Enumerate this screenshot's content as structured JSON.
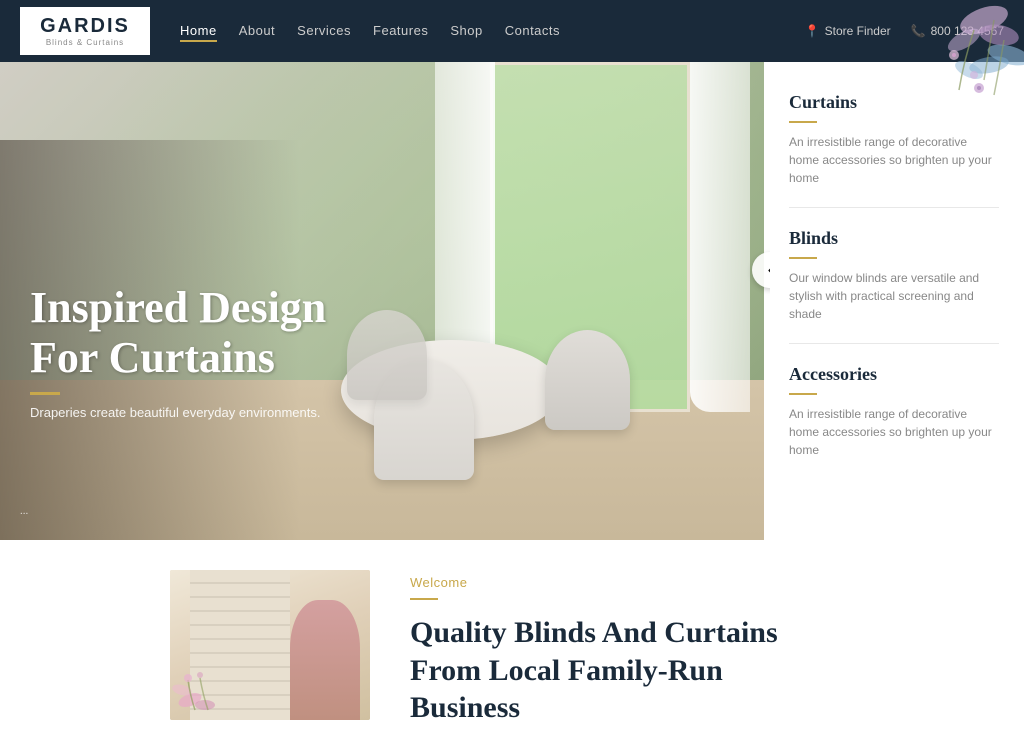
{
  "brand": {
    "name": "GARDIS",
    "sub": "Blinds & Curtains"
  },
  "navbar": {
    "links": [
      {
        "label": "Home",
        "active": true
      },
      {
        "label": "About",
        "active": false
      },
      {
        "label": "Services",
        "active": false
      },
      {
        "label": "Features",
        "active": false
      },
      {
        "label": "Shop",
        "active": false
      },
      {
        "label": "Contacts",
        "active": false
      }
    ],
    "store_finder": "Store Finder",
    "phone": "800 123 4567"
  },
  "hero": {
    "title": "Inspired Design\nFor Curtains",
    "gold_bar": true,
    "subtitle": "Draperies create beautiful everyday environments."
  },
  "sidebar": {
    "items": [
      {
        "title": "Curtains",
        "desc": "An irresistible range of decorative home accessories so brighten up your home"
      },
      {
        "title": "Blinds",
        "desc": "Our window blinds are versatile and stylish with practical screening and shade"
      },
      {
        "title": "Accessories",
        "desc": "An irresistible range of decorative home accessories so brighten up your home"
      }
    ]
  },
  "welcome": {
    "label": "Welcome",
    "title": "Quality Blinds And Curtains\nFrom Local Family-Run\nBusiness"
  },
  "icons": {
    "location": "📍",
    "phone": "📞",
    "arrow_left": "‹",
    "dots": "∙∙∙"
  }
}
